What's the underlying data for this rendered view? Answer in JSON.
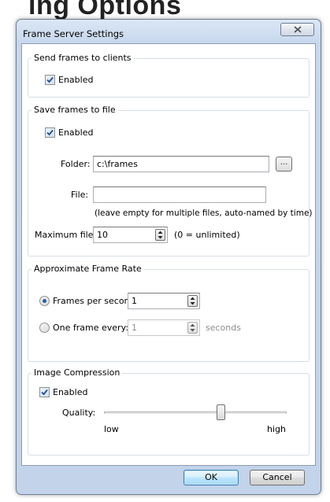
{
  "background": {
    "heading": "ing Options"
  },
  "window": {
    "title": "Frame Server Settings"
  },
  "send": {
    "group_title": "Send frames to clients",
    "enabled_label": "Enabled",
    "enabled_checked": true
  },
  "save": {
    "group_title": "Save frames to file",
    "enabled_label": "Enabled",
    "enabled_checked": true,
    "folder_label": "Folder:",
    "folder_value": "c:\\frames",
    "browse_label": "...",
    "file_label": "File:",
    "file_value": "",
    "file_hint": "(leave empty for multiple files, auto-named by time)",
    "max_label": "Maximum files:",
    "max_value": "10",
    "max_hint": "(0 = unlimited)"
  },
  "rate": {
    "group_title": "Approximate Frame Rate",
    "fps_label": "Frames per second:",
    "fps_value": "1",
    "fps_selected": true,
    "every_label": "One frame every:",
    "every_value": "1",
    "every_unit": "seconds",
    "every_selected": false
  },
  "compression": {
    "group_title": "Image Compression",
    "enabled_label": "Enabled",
    "enabled_checked": true,
    "quality_label": "Quality:",
    "low_label": "low",
    "high_label": "high",
    "quality_fraction": 0.64
  },
  "buttons": {
    "ok": "OK",
    "cancel": "Cancel"
  },
  "icons": {
    "close": "close-icon",
    "check": "checkmark-icon",
    "spin": "spin-arrows-icon"
  },
  "colors": {
    "accent": "#1c5fb3",
    "check": "#1f4e8c",
    "titlebar": "#c7d7ec"
  }
}
